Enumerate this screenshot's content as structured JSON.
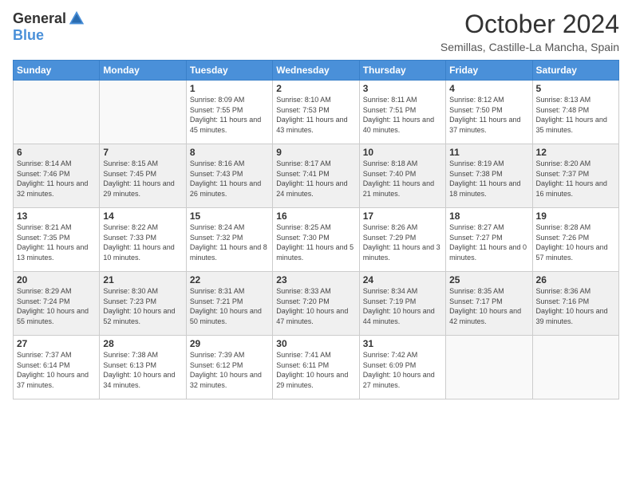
{
  "header": {
    "logo_general": "General",
    "logo_blue": "Blue",
    "month_title": "October 2024",
    "location": "Semillas, Castille-La Mancha, Spain"
  },
  "days_of_week": [
    "Sunday",
    "Monday",
    "Tuesday",
    "Wednesday",
    "Thursday",
    "Friday",
    "Saturday"
  ],
  "weeks": [
    [
      {
        "num": "",
        "info": ""
      },
      {
        "num": "",
        "info": ""
      },
      {
        "num": "1",
        "info": "Sunrise: 8:09 AM\nSunset: 7:55 PM\nDaylight: 11 hours and 45 minutes."
      },
      {
        "num": "2",
        "info": "Sunrise: 8:10 AM\nSunset: 7:53 PM\nDaylight: 11 hours and 43 minutes."
      },
      {
        "num": "3",
        "info": "Sunrise: 8:11 AM\nSunset: 7:51 PM\nDaylight: 11 hours and 40 minutes."
      },
      {
        "num": "4",
        "info": "Sunrise: 8:12 AM\nSunset: 7:50 PM\nDaylight: 11 hours and 37 minutes."
      },
      {
        "num": "5",
        "info": "Sunrise: 8:13 AM\nSunset: 7:48 PM\nDaylight: 11 hours and 35 minutes."
      }
    ],
    [
      {
        "num": "6",
        "info": "Sunrise: 8:14 AM\nSunset: 7:46 PM\nDaylight: 11 hours and 32 minutes."
      },
      {
        "num": "7",
        "info": "Sunrise: 8:15 AM\nSunset: 7:45 PM\nDaylight: 11 hours and 29 minutes."
      },
      {
        "num": "8",
        "info": "Sunrise: 8:16 AM\nSunset: 7:43 PM\nDaylight: 11 hours and 26 minutes."
      },
      {
        "num": "9",
        "info": "Sunrise: 8:17 AM\nSunset: 7:41 PM\nDaylight: 11 hours and 24 minutes."
      },
      {
        "num": "10",
        "info": "Sunrise: 8:18 AM\nSunset: 7:40 PM\nDaylight: 11 hours and 21 minutes."
      },
      {
        "num": "11",
        "info": "Sunrise: 8:19 AM\nSunset: 7:38 PM\nDaylight: 11 hours and 18 minutes."
      },
      {
        "num": "12",
        "info": "Sunrise: 8:20 AM\nSunset: 7:37 PM\nDaylight: 11 hours and 16 minutes."
      }
    ],
    [
      {
        "num": "13",
        "info": "Sunrise: 8:21 AM\nSunset: 7:35 PM\nDaylight: 11 hours and 13 minutes."
      },
      {
        "num": "14",
        "info": "Sunrise: 8:22 AM\nSunset: 7:33 PM\nDaylight: 11 hours and 10 minutes."
      },
      {
        "num": "15",
        "info": "Sunrise: 8:24 AM\nSunset: 7:32 PM\nDaylight: 11 hours and 8 minutes."
      },
      {
        "num": "16",
        "info": "Sunrise: 8:25 AM\nSunset: 7:30 PM\nDaylight: 11 hours and 5 minutes."
      },
      {
        "num": "17",
        "info": "Sunrise: 8:26 AM\nSunset: 7:29 PM\nDaylight: 11 hours and 3 minutes."
      },
      {
        "num": "18",
        "info": "Sunrise: 8:27 AM\nSunset: 7:27 PM\nDaylight: 11 hours and 0 minutes."
      },
      {
        "num": "19",
        "info": "Sunrise: 8:28 AM\nSunset: 7:26 PM\nDaylight: 10 hours and 57 minutes."
      }
    ],
    [
      {
        "num": "20",
        "info": "Sunrise: 8:29 AM\nSunset: 7:24 PM\nDaylight: 10 hours and 55 minutes."
      },
      {
        "num": "21",
        "info": "Sunrise: 8:30 AM\nSunset: 7:23 PM\nDaylight: 10 hours and 52 minutes."
      },
      {
        "num": "22",
        "info": "Sunrise: 8:31 AM\nSunset: 7:21 PM\nDaylight: 10 hours and 50 minutes."
      },
      {
        "num": "23",
        "info": "Sunrise: 8:33 AM\nSunset: 7:20 PM\nDaylight: 10 hours and 47 minutes."
      },
      {
        "num": "24",
        "info": "Sunrise: 8:34 AM\nSunset: 7:19 PM\nDaylight: 10 hours and 44 minutes."
      },
      {
        "num": "25",
        "info": "Sunrise: 8:35 AM\nSunset: 7:17 PM\nDaylight: 10 hours and 42 minutes."
      },
      {
        "num": "26",
        "info": "Sunrise: 8:36 AM\nSunset: 7:16 PM\nDaylight: 10 hours and 39 minutes."
      }
    ],
    [
      {
        "num": "27",
        "info": "Sunrise: 7:37 AM\nSunset: 6:14 PM\nDaylight: 10 hours and 37 minutes."
      },
      {
        "num": "28",
        "info": "Sunrise: 7:38 AM\nSunset: 6:13 PM\nDaylight: 10 hours and 34 minutes."
      },
      {
        "num": "29",
        "info": "Sunrise: 7:39 AM\nSunset: 6:12 PM\nDaylight: 10 hours and 32 minutes."
      },
      {
        "num": "30",
        "info": "Sunrise: 7:41 AM\nSunset: 6:11 PM\nDaylight: 10 hours and 29 minutes."
      },
      {
        "num": "31",
        "info": "Sunrise: 7:42 AM\nSunset: 6:09 PM\nDaylight: 10 hours and 27 minutes."
      },
      {
        "num": "",
        "info": ""
      },
      {
        "num": "",
        "info": ""
      }
    ]
  ]
}
